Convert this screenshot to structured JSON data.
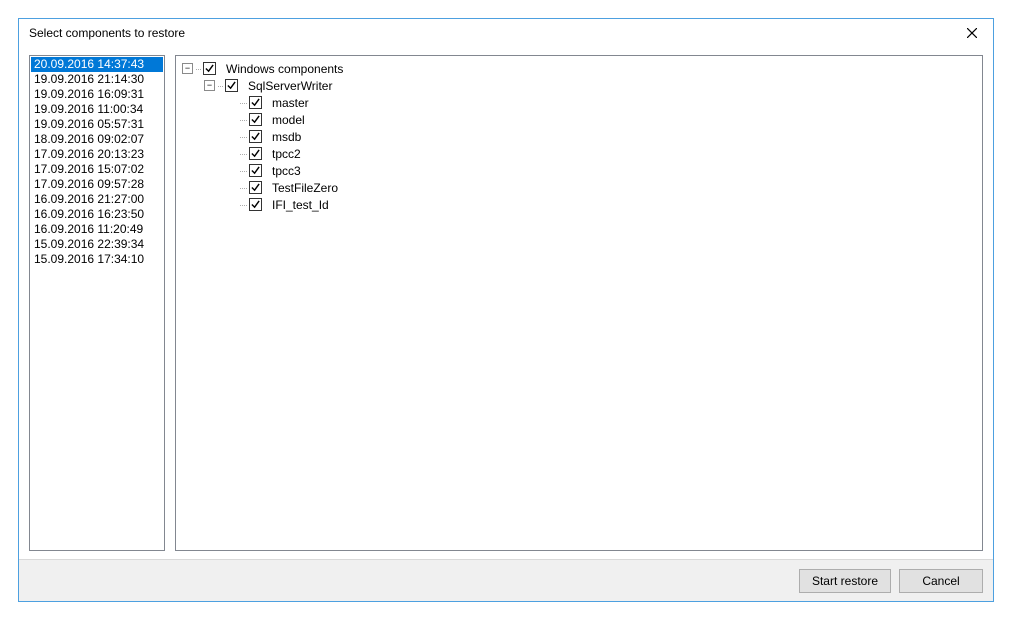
{
  "window": {
    "title": "Select components to restore"
  },
  "snapshots": [
    {
      "ts": "20.09.2016 14:37:43",
      "selected": true
    },
    {
      "ts": "19.09.2016 21:14:30",
      "selected": false
    },
    {
      "ts": "19.09.2016 16:09:31",
      "selected": false
    },
    {
      "ts": "19.09.2016 11:00:34",
      "selected": false
    },
    {
      "ts": "19.09.2016 05:57:31",
      "selected": false
    },
    {
      "ts": "18.09.2016 09:02:07",
      "selected": false
    },
    {
      "ts": "17.09.2016 20:13:23",
      "selected": false
    },
    {
      "ts": "17.09.2016 15:07:02",
      "selected": false
    },
    {
      "ts": "17.09.2016 09:57:28",
      "selected": false
    },
    {
      "ts": "16.09.2016 21:27:00",
      "selected": false
    },
    {
      "ts": "16.09.2016 16:23:50",
      "selected": false
    },
    {
      "ts": "16.09.2016 11:20:49",
      "selected": false
    },
    {
      "ts": "15.09.2016 22:39:34",
      "selected": false
    },
    {
      "ts": "15.09.2016 17:34:10",
      "selected": false
    }
  ],
  "tree": {
    "root": {
      "label": "Windows components",
      "checked": true,
      "expanded": true,
      "children_label": "SqlServerWriter",
      "child_checked": true,
      "child_expanded": true,
      "leaves": [
        {
          "label": "master",
          "checked": true
        },
        {
          "label": "model",
          "checked": true
        },
        {
          "label": "msdb",
          "checked": true
        },
        {
          "label": "tpcc2",
          "checked": true
        },
        {
          "label": "tpcc3",
          "checked": true
        },
        {
          "label": "TestFileZero",
          "checked": true
        },
        {
          "label": "IFI_test_Id",
          "checked": true
        }
      ]
    }
  },
  "footer": {
    "start_label": "Start restore",
    "cancel_label": "Cancel"
  }
}
